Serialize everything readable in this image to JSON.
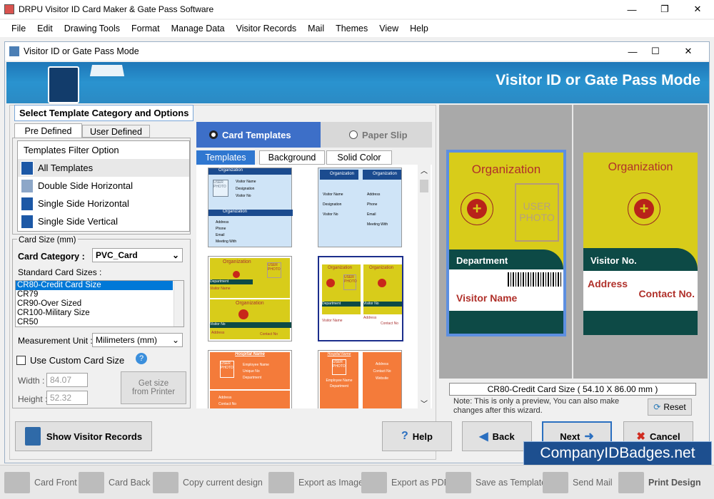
{
  "app": {
    "title": "DRPU Visitor ID Card Maker & Gate Pass Software",
    "menu": [
      "File",
      "Edit",
      "Drawing Tools",
      "Format",
      "Manage Data",
      "Visitor Records",
      "Mail",
      "Themes",
      "View",
      "Help"
    ]
  },
  "dialog": {
    "title": "Visitor ID or Gate Pass Mode",
    "banner_title": "Visitor ID or Gate Pass Mode",
    "section_label": "Select Template Category and Options"
  },
  "tabs": {
    "pre": "Pre Defined",
    "user": "User Defined"
  },
  "filter": {
    "header": "Templates Filter Option",
    "items": [
      "All Templates",
      "Double Side Horizontal",
      "Single Side Horizontal",
      "Single Side Vertical"
    ]
  },
  "card_size": {
    "group": "Card Size (mm)",
    "category_label": "Card Category :",
    "category_value": "PVC_Card",
    "standard_label": "Standard Card Sizes :",
    "sizes": [
      "CR80-Credit Card Size",
      "CR79",
      "CR90-Over Sized",
      "CR100-Military Size",
      "CR50"
    ],
    "unit_label": "Measurement Unit :",
    "unit_value": "Milimeters (mm)",
    "custom_label": "Use Custom Card Size",
    "width_label": "Width :",
    "width_value": "84.07",
    "height_label": "Height :",
    "height_value": "52.32",
    "printer_btn1": "Get size",
    "printer_btn2": "from Printer"
  },
  "modes": {
    "card": "Card Templates",
    "paper": "Paper Slip"
  },
  "subtabs": [
    "Templates",
    "Background",
    "Solid Color"
  ],
  "thumbs": {
    "org": "Organization",
    "user_photo": "USER PHOTO",
    "visitor_name": "Visitor Name",
    "designation": "Designation",
    "visitor_no": "Visitor No",
    "address": "Address",
    "phone": "Phone",
    "email": "Email",
    "meeting": "Meeting With",
    "department": "Department",
    "contact": "Contact No",
    "hospital": "Hospital Name",
    "employee": "Employee Name",
    "unique": "Unique No",
    "website": "Website"
  },
  "preview": {
    "front": {
      "org": "Organization",
      "photo1": "USER",
      "photo2": "PHOTO",
      "dept": "Department",
      "name": "Visitor Name"
    },
    "back": {
      "org": "Organization",
      "visitor_no": "Visitor No.",
      "address": "Address",
      "contact": "Contact No."
    },
    "size": "CR80-Credit Card Size ( 54.10 X 86.00 mm )",
    "note": "Note: This is only a preview, You can also make changes after this wizard.",
    "reset": "Reset"
  },
  "buttons": {
    "show_records": "Show Visitor Records",
    "help": "Help",
    "back": "Back",
    "next": "Next",
    "cancel": "Cancel"
  },
  "watermark": "CompanyIDBadges.net",
  "bottom": [
    "Card Front",
    "Card Back",
    "Copy current design",
    "Export as Image",
    "Export as PDF",
    "Save as Template",
    "Send Mail",
    "Print Design"
  ],
  "colors": {
    "banner": "#2a8ac4",
    "card_yellow": "#d8cc1a",
    "card_green": "#0d4a46",
    "accent": "#1c58a6"
  }
}
